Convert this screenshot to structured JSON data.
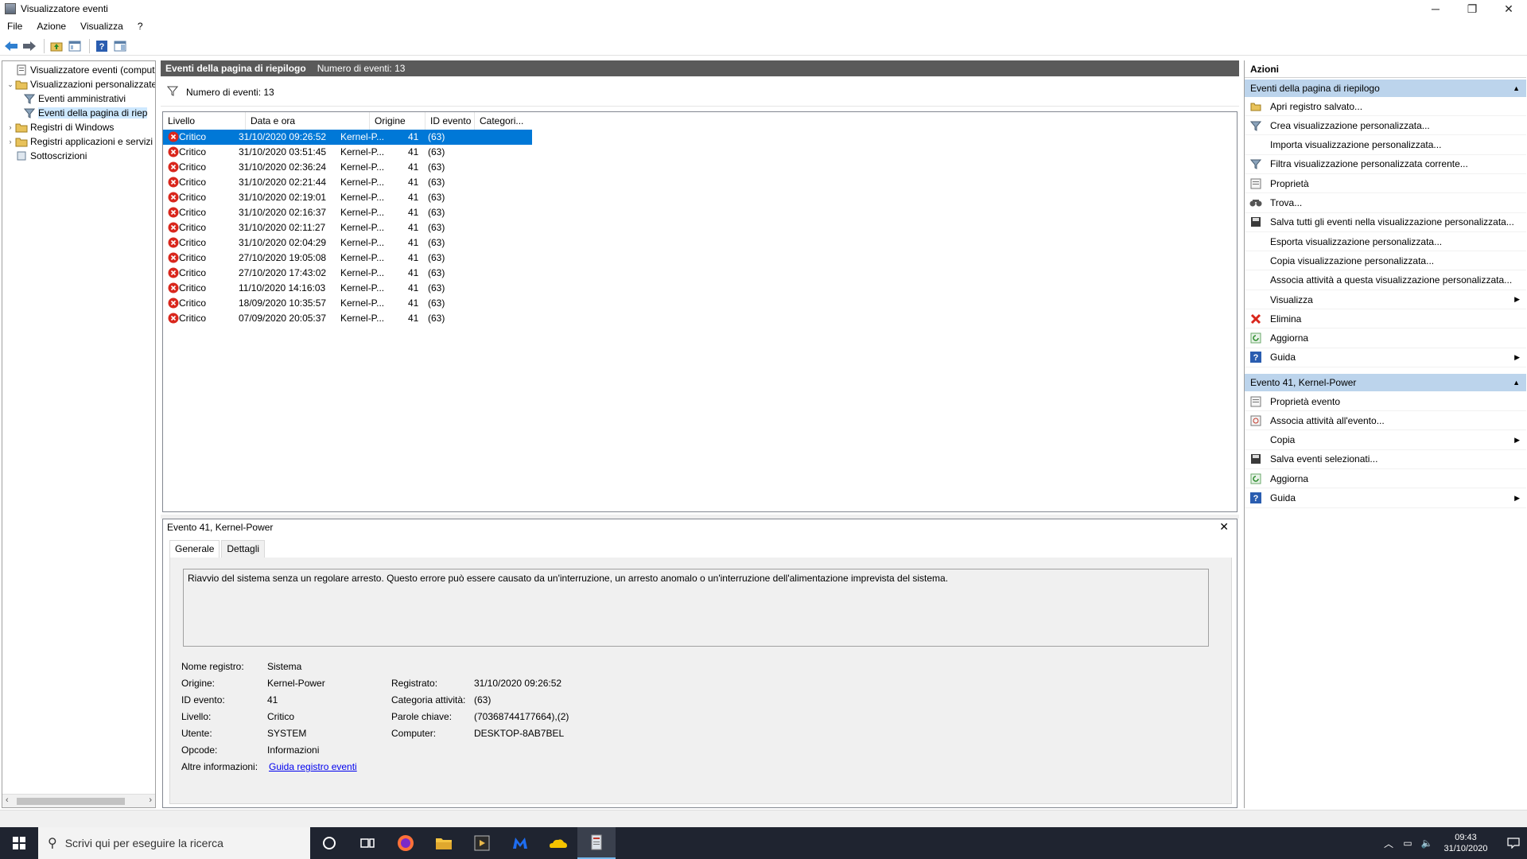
{
  "window": {
    "title": "Visualizzatore eventi",
    "controls": {
      "minimize": "─",
      "restore": "❐",
      "close": "✕"
    }
  },
  "menu": [
    "File",
    "Azione",
    "Visualizza",
    "?"
  ],
  "tree": {
    "items": [
      {
        "label": "Visualizzatore eventi (computer",
        "icon": "event-viewer-icon",
        "exp": ""
      },
      {
        "label": "Visualizzazioni personalizzate",
        "icon": "folder-icon",
        "exp": "⌄"
      },
      {
        "label": "Eventi amministrativi",
        "icon": "filter-icon",
        "exp": ""
      },
      {
        "label": "Eventi della pagina di riep",
        "icon": "filter-icon",
        "exp": ""
      },
      {
        "label": "Registri di Windows",
        "icon": "folder-icon",
        "exp": "›"
      },
      {
        "label": "Registri applicazioni e servizi",
        "icon": "folder-icon",
        "exp": "›"
      },
      {
        "label": "Sottoscrizioni",
        "icon": "subscriptions-icon",
        "exp": ""
      }
    ]
  },
  "middle": {
    "header_title": "Eventi della pagina di riepilogo",
    "header_count": "Numero di eventi: 13",
    "filter_text": "Numero di eventi: 13",
    "columns": [
      "Livello",
      "Data e ora",
      "Origine",
      "ID evento",
      "Categori..."
    ],
    "rows": [
      {
        "level": "Critico",
        "date": "31/10/2020 09:26:52",
        "source": "Kernel-P...",
        "id": "41",
        "cat": "(63)"
      },
      {
        "level": "Critico",
        "date": "31/10/2020 03:51:45",
        "source": "Kernel-P...",
        "id": "41",
        "cat": "(63)"
      },
      {
        "level": "Critico",
        "date": "31/10/2020 02:36:24",
        "source": "Kernel-P...",
        "id": "41",
        "cat": "(63)"
      },
      {
        "level": "Critico",
        "date": "31/10/2020 02:21:44",
        "source": "Kernel-P...",
        "id": "41",
        "cat": "(63)"
      },
      {
        "level": "Critico",
        "date": "31/10/2020 02:19:01",
        "source": "Kernel-P...",
        "id": "41",
        "cat": "(63)"
      },
      {
        "level": "Critico",
        "date": "31/10/2020 02:16:37",
        "source": "Kernel-P...",
        "id": "41",
        "cat": "(63)"
      },
      {
        "level": "Critico",
        "date": "31/10/2020 02:11:27",
        "source": "Kernel-P...",
        "id": "41",
        "cat": "(63)"
      },
      {
        "level": "Critico",
        "date": "31/10/2020 02:04:29",
        "source": "Kernel-P...",
        "id": "41",
        "cat": "(63)"
      },
      {
        "level": "Critico",
        "date": "27/10/2020 19:05:08",
        "source": "Kernel-P...",
        "id": "41",
        "cat": "(63)"
      },
      {
        "level": "Critico",
        "date": "27/10/2020 17:43:02",
        "source": "Kernel-P...",
        "id": "41",
        "cat": "(63)"
      },
      {
        "level": "Critico",
        "date": "11/10/2020 14:16:03",
        "source": "Kernel-P...",
        "id": "41",
        "cat": "(63)"
      },
      {
        "level": "Critico",
        "date": "18/09/2020 10:35:57",
        "source": "Kernel-P...",
        "id": "41",
        "cat": "(63)"
      },
      {
        "level": "Critico",
        "date": "07/09/2020 20:05:37",
        "source": "Kernel-P...",
        "id": "41",
        "cat": "(63)"
      }
    ]
  },
  "details": {
    "title": "Evento 41, Kernel-Power",
    "close": "✕",
    "tabs": [
      "Generale",
      "Dettagli"
    ],
    "description": "Riavvio del sistema senza un regolare arresto. Questo errore può essere causato da un'interruzione, un arresto anomalo o un'interruzione dell'alimentazione imprevista del sistema.",
    "left_props": [
      {
        "label": "Nome registro:",
        "value": "Sistema"
      },
      {
        "label": "Origine:",
        "value": "Kernel-Power"
      },
      {
        "label": "ID evento:",
        "value": "41"
      },
      {
        "label": "Livello:",
        "value": "Critico"
      },
      {
        "label": "Utente:",
        "value": "SYSTEM"
      },
      {
        "label": "Opcode:",
        "value": "Informazioni"
      }
    ],
    "right_props": [
      {
        "label": "Registrato:",
        "value": "31/10/2020 09:26:52"
      },
      {
        "label": "Categoria attività:",
        "value": "(63)"
      },
      {
        "label": "Parole chiave:",
        "value": "(70368744177664),(2)"
      },
      {
        "label": "Computer:",
        "value": "DESKTOP-8AB7BEL"
      }
    ],
    "more_info_label": "Altre informazioni:",
    "more_info_link": "Guida registro eventi"
  },
  "actions": {
    "title": "Azioni",
    "section1": {
      "title": "Eventi della pagina di riepilogo",
      "items": [
        {
          "label": "Apri registro salvato...",
          "icon": "open-log-icon",
          "submenu": false
        },
        {
          "label": "Crea visualizzazione personalizzata...",
          "icon": "filter-icon",
          "submenu": false
        },
        {
          "label": "Importa visualizzazione personalizzata...",
          "icon": "",
          "submenu": false
        },
        {
          "label": "Filtra visualizzazione personalizzata corrente...",
          "icon": "filter-icon",
          "submenu": false
        },
        {
          "label": "Proprietà",
          "icon": "properties-icon",
          "submenu": false
        },
        {
          "label": "Trova...",
          "icon": "find-icon",
          "submenu": false
        },
        {
          "label": "Salva tutti gli eventi nella visualizzazione personalizzata...",
          "icon": "save-icon",
          "submenu": false
        },
        {
          "label": "Esporta visualizzazione personalizzata...",
          "icon": "",
          "submenu": false
        },
        {
          "label": "Copia visualizzazione personalizzata...",
          "icon": "",
          "submenu": false
        },
        {
          "label": "Associa attività a questa visualizzazione personalizzata...",
          "icon": "",
          "submenu": false
        },
        {
          "label": "Visualizza",
          "icon": "",
          "submenu": true
        },
        {
          "label": "Elimina",
          "icon": "delete-icon",
          "submenu": false
        },
        {
          "label": "Aggiorna",
          "icon": "refresh-icon",
          "submenu": false
        },
        {
          "label": "Guida",
          "icon": "help-icon",
          "submenu": true
        }
      ]
    },
    "section2": {
      "title": "Evento 41, Kernel-Power",
      "items": [
        {
          "label": "Proprietà evento",
          "icon": "properties-icon",
          "submenu": false
        },
        {
          "label": "Associa attività all'evento...",
          "icon": "task-icon",
          "submenu": false
        },
        {
          "label": "Copia",
          "icon": "",
          "submenu": true
        },
        {
          "label": "Salva eventi selezionati...",
          "icon": "save-icon",
          "submenu": false
        },
        {
          "label": "Aggiorna",
          "icon": "refresh-icon",
          "submenu": false
        },
        {
          "label": "Guida",
          "icon": "help-icon",
          "submenu": true
        }
      ]
    }
  },
  "taskbar": {
    "search_placeholder": "Scrivi qui per eseguire la ricerca",
    "time": "09:43",
    "date": "31/10/2020"
  },
  "colors": {
    "selection": "#0078d7",
    "section_header": "#bcd4ec",
    "critical": "#d9261c",
    "taskbar": "#1f2430"
  }
}
